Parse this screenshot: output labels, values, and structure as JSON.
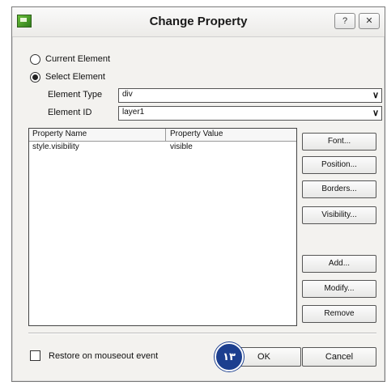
{
  "window": {
    "title": "Change Property",
    "help_glyph": "?",
    "close_glyph": "✕"
  },
  "scope": {
    "current_element_label": "Current Element",
    "select_element_label": "Select Element",
    "selected": "select_element"
  },
  "fields": {
    "element_type_label": "Element Type",
    "element_type_value": "div",
    "element_id_label": "Element ID",
    "element_id_value": "layer1"
  },
  "properties": {
    "columns": [
      "Property Name",
      "Property Value"
    ],
    "rows": [
      [
        "style.visibility",
        "visible"
      ]
    ]
  },
  "side_buttons": {
    "font": "Font...",
    "position": "Position...",
    "borders": "Borders...",
    "visibility": "Visibility...",
    "add": "Add...",
    "modify": "Modify...",
    "remove": "Remove"
  },
  "footer": {
    "restore_label": "Restore on mouseout event",
    "restore_checked": false,
    "ok": "OK",
    "cancel": "Cancel",
    "step_badge": "۱۳"
  },
  "colors": {
    "badge": "#1c3f8f",
    "dialog_bg": "#f3f2ef"
  },
  "icons": {
    "app": "app-icon",
    "dropdown": "chevron-down-icon"
  }
}
